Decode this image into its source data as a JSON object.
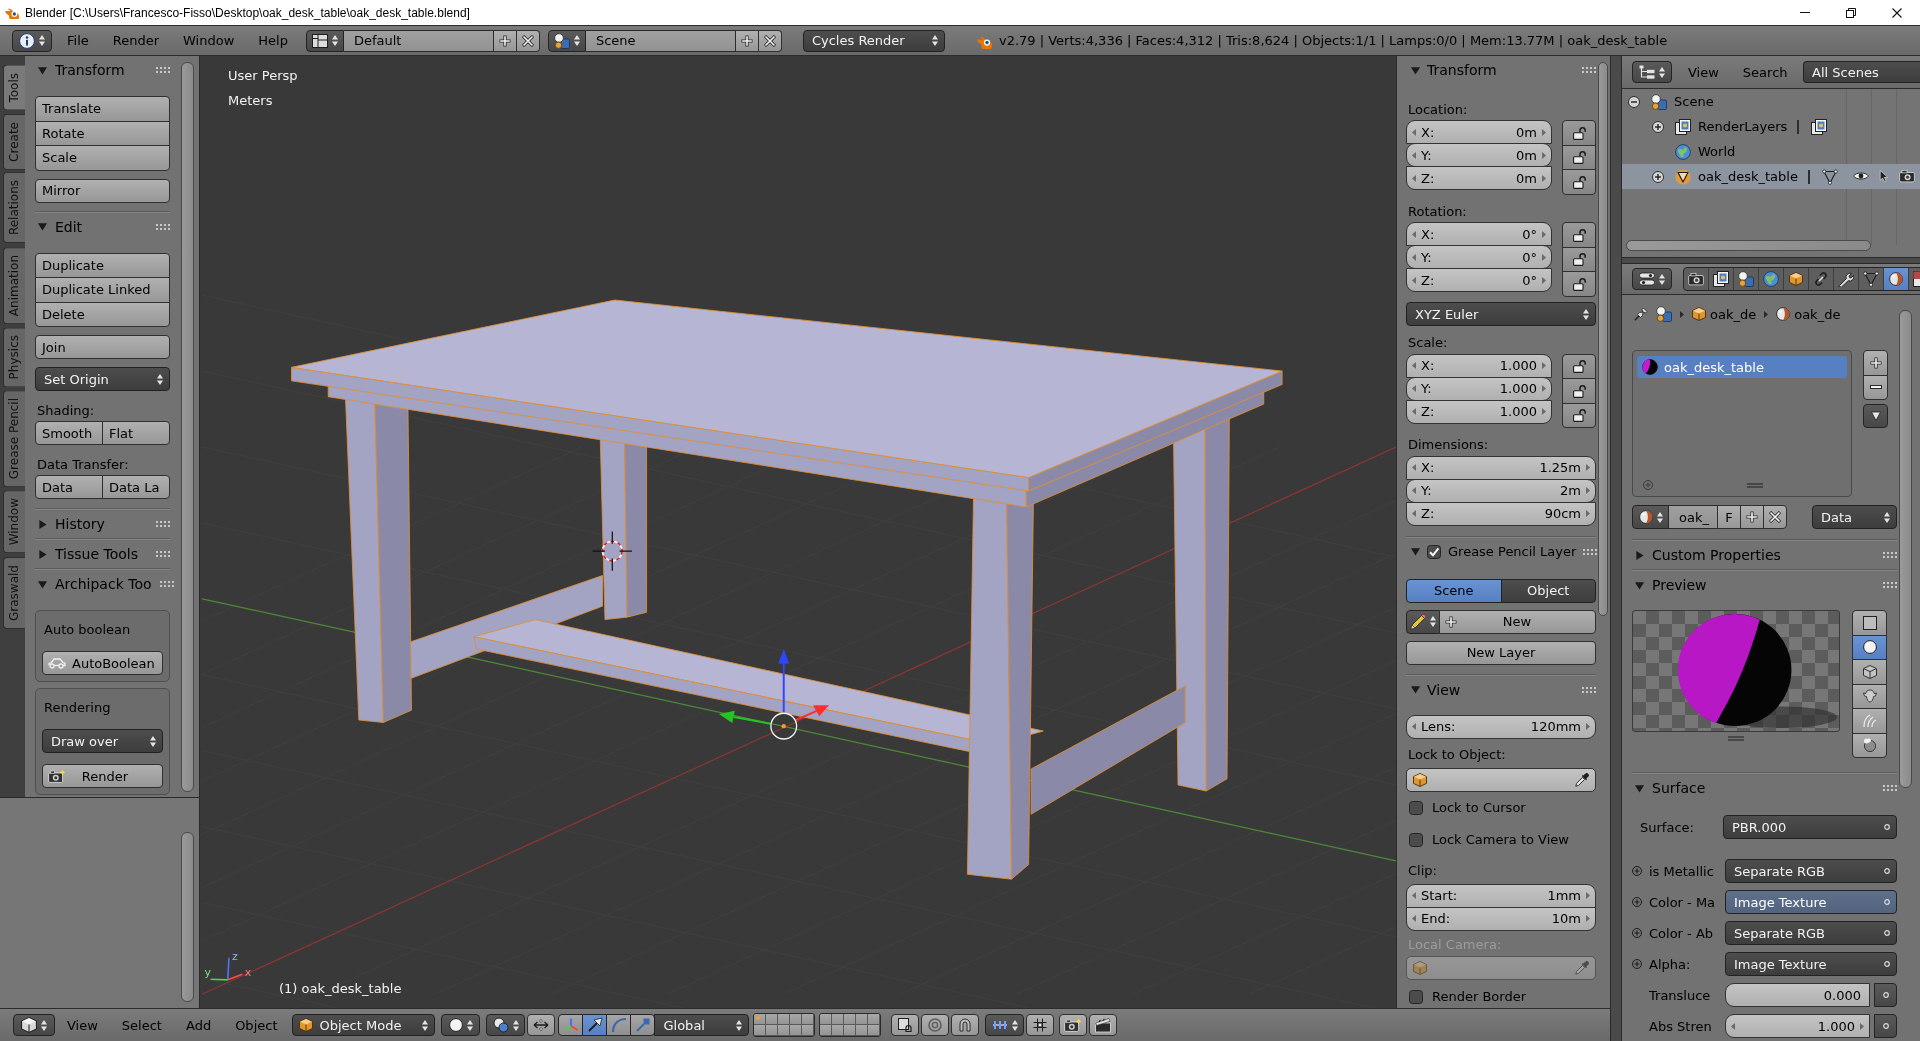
{
  "window": {
    "title": "Blender [C:\\Users\\Francesco-Fisso\\Desktop\\oak_desk_table\\oak_desk_table.blend]"
  },
  "info_header": {
    "menus": [
      "File",
      "Render",
      "Window",
      "Help"
    ],
    "screen_layout": "Default",
    "scene": "Scene",
    "render_engine": "Cycles Render",
    "stats": "v2.79 | Verts:4,336 | Faces:4,312 | Tris:8,624 | Objects:1/1 | Lamps:0/0 | Mem:13.77M | oak_desk_table"
  },
  "tool_shelf": {
    "tabs": [
      {
        "label": "Tools",
        "selected": true
      },
      {
        "label": "Create",
        "selected": false
      },
      {
        "label": "Relations",
        "selected": false
      },
      {
        "label": "Animation",
        "selected": false
      },
      {
        "label": "Physics",
        "selected": false
      },
      {
        "label": "Grease Pencil",
        "selected": false
      },
      {
        "label": "Window",
        "selected": false
      },
      {
        "label": "Graswald",
        "selected": false
      }
    ],
    "transform": {
      "title": "Transform",
      "expanded": true,
      "buttons": [
        "Translate",
        "Rotate",
        "Scale"
      ],
      "mirror": "Mirror"
    },
    "edit": {
      "title": "Edit",
      "expanded": true,
      "buttons": [
        "Duplicate",
        "Duplicate Linked",
        "Delete"
      ],
      "join": "Join",
      "set_origin": "Set Origin",
      "shading_label": "Shading:",
      "shading": [
        "Smooth",
        "Flat"
      ],
      "data_transfer_label": "Data Transfer:",
      "data_transfer": [
        "Data",
        "Data La"
      ]
    },
    "history": {
      "title": "History",
      "expanded": false
    },
    "tissue_tools": {
      "title": "Tissue Tools",
      "expanded": false
    },
    "archipack": {
      "title": "Archipack Too",
      "expanded": true,
      "auto_boolean_label": "Auto boolean",
      "auto_boolean_button": "AutoBoolean",
      "rendering_label": "Rendering",
      "draw_mode": "Draw over",
      "render_button": "Render"
    }
  },
  "viewport": {
    "view_name": "User Persp",
    "units": "Meters",
    "axis_labels": [
      "z",
      "y",
      "x"
    ],
    "object_info": "(1) oak_desk_table"
  },
  "properties_region": {
    "transform": {
      "title": "Transform",
      "expanded": true,
      "location": {
        "label": "Location:",
        "fields": [
          {
            "axis": "X:",
            "value": "0m",
            "locked": false
          },
          {
            "axis": "Y:",
            "value": "0m",
            "locked": false
          },
          {
            "axis": "Z:",
            "value": "0m",
            "locked": false
          }
        ]
      },
      "rotation": {
        "label": "Rotation:",
        "fields": [
          {
            "axis": "X:",
            "value": "0°",
            "locked": false
          },
          {
            "axis": "Y:",
            "value": "0°",
            "locked": false
          },
          {
            "axis": "Z:",
            "value": "0°",
            "locked": false
          }
        ]
      },
      "rotation_mode": "XYZ Euler",
      "scale": {
        "label": "Scale:",
        "fields": [
          {
            "axis": "X:",
            "value": "1.000",
            "locked": false
          },
          {
            "axis": "Y:",
            "value": "1.000",
            "locked": false
          },
          {
            "axis": "Z:",
            "value": "1.000",
            "locked": false
          }
        ]
      },
      "dimensions": {
        "label": "Dimensions:",
        "fields": [
          {
            "axis": "X:",
            "value": "1.25m"
          },
          {
            "axis": "Y:",
            "value": "2m"
          },
          {
            "axis": "Z:",
            "value": "90cm"
          }
        ]
      }
    },
    "grease_pencil": {
      "title": "Grease Pencil Layer",
      "expanded": true,
      "enabled": true,
      "source": [
        {
          "label": "Scene",
          "selected": true
        },
        {
          "label": "Object",
          "selected": false
        }
      ],
      "new_button": "New",
      "new_layer_button": "New Layer"
    },
    "view": {
      "title": "View",
      "expanded": true,
      "lens": {
        "label": "Lens:",
        "value": "120mm"
      },
      "lock_to_object_label": "Lock to Object:",
      "options": [
        {
          "label": "Lock to Cursor",
          "checked": false
        },
        {
          "label": "Lock Camera to View",
          "checked": false
        }
      ],
      "clip_label": "Clip:",
      "clip": [
        {
          "label": "Start:",
          "value": "1mm"
        },
        {
          "label": "End:",
          "value": "10m"
        }
      ],
      "local_camera_label": "Local Camera:",
      "local_camera_disabled": true,
      "render_border": {
        "label": "Render Border",
        "checked": false
      }
    }
  },
  "outliner": {
    "menus": [
      "View",
      "Search"
    ],
    "filter": "All Scenes",
    "tree": [
      {
        "name": "Scene",
        "kind": "scene",
        "expanded": true,
        "selected": false,
        "children": [
          {
            "name": "RenderLayers",
            "kind": "render_layers",
            "expanded": false,
            "selected": false
          },
          {
            "name": "World",
            "kind": "world",
            "selected": false
          },
          {
            "name": "oak_desk_table",
            "kind": "mesh_object",
            "expanded": false,
            "selected": true
          }
        ]
      }
    ]
  },
  "properties_editor": {
    "tabs": [
      {
        "kind": "render",
        "selected": false
      },
      {
        "kind": "render_layers",
        "selected": false
      },
      {
        "kind": "scene",
        "selected": false
      },
      {
        "kind": "world",
        "selected": false
      },
      {
        "kind": "object",
        "selected": false
      },
      {
        "kind": "constraints",
        "selected": false
      },
      {
        "kind": "modifiers",
        "selected": false
      },
      {
        "kind": "data",
        "selected": false
      },
      {
        "kind": "material",
        "selected": true
      },
      {
        "kind": "texture",
        "selected": false
      }
    ],
    "breadcrumb": [
      {
        "kind": "scene"
      },
      {
        "kind": "object",
        "label": "oak_de"
      },
      {
        "kind": "material",
        "label": "oak_de"
      }
    ],
    "material_slots": [
      {
        "name": "oak_desk_table",
        "selected": true
      }
    ],
    "material_id": {
      "name": "oak_",
      "fake_user": "F",
      "link": "Data"
    },
    "custom_properties": {
      "title": "Custom Properties",
      "expanded": false
    },
    "preview": {
      "title": "Preview",
      "expanded": true,
      "shapes": [
        {
          "kind": "flat",
          "selected": false
        },
        {
          "kind": "sphere",
          "selected": true
        },
        {
          "kind": "cube",
          "selected": false
        },
        {
          "kind": "monkey",
          "selected": false
        },
        {
          "kind": "hair",
          "selected": false
        },
        {
          "kind": "sky",
          "selected": false
        }
      ]
    },
    "surface": {
      "title": "Surface",
      "expanded": true,
      "surface": {
        "label": "Surface:",
        "value": "PBR.000"
      },
      "inputs": [
        {
          "kind": "link",
          "label": "is Metallic",
          "value": "Separate RGB",
          "highlighted": false
        },
        {
          "kind": "link",
          "label": "Color - Ma",
          "value": "Image Texture",
          "highlighted": true
        },
        {
          "kind": "link",
          "label": "Color - Ab",
          "value": "Separate RGB",
          "highlighted": false
        },
        {
          "kind": "link",
          "label": "Alpha:",
          "value": "Image Texture",
          "highlighted": false
        },
        {
          "kind": "factor",
          "label": "Transluce",
          "value": "0.000"
        },
        {
          "kind": "number",
          "label": "Abs Stren",
          "value": "1.000"
        }
      ]
    }
  },
  "view3d_header": {
    "menus": [
      "View",
      "Select",
      "Add",
      "Object"
    ],
    "mode": "Object Mode",
    "manipulators": [
      {
        "kind": "axes",
        "selected": false
      },
      {
        "kind": "translate",
        "selected": true
      },
      {
        "kind": "rotate",
        "selected": false
      },
      {
        "kind": "scale",
        "selected": false
      }
    ],
    "orientation": "Global",
    "layers": [
      {
        "used": true
      },
      {
        "used": false
      },
      {
        "used": false
      },
      {
        "used": false
      },
      {
        "used": false
      },
      {
        "used": false
      },
      {
        "used": false
      },
      {
        "used": false
      },
      {
        "used": false
      },
      {
        "used": false
      },
      {
        "used": false
      },
      {
        "used": false
      },
      {
        "used": false
      },
      {
        "used": false
      },
      {
        "used": false
      },
      {
        "used": false
      },
      {
        "used": false
      },
      {
        "used": false
      },
      {
        "used": false
      },
      {
        "used": false
      }
    ]
  }
}
